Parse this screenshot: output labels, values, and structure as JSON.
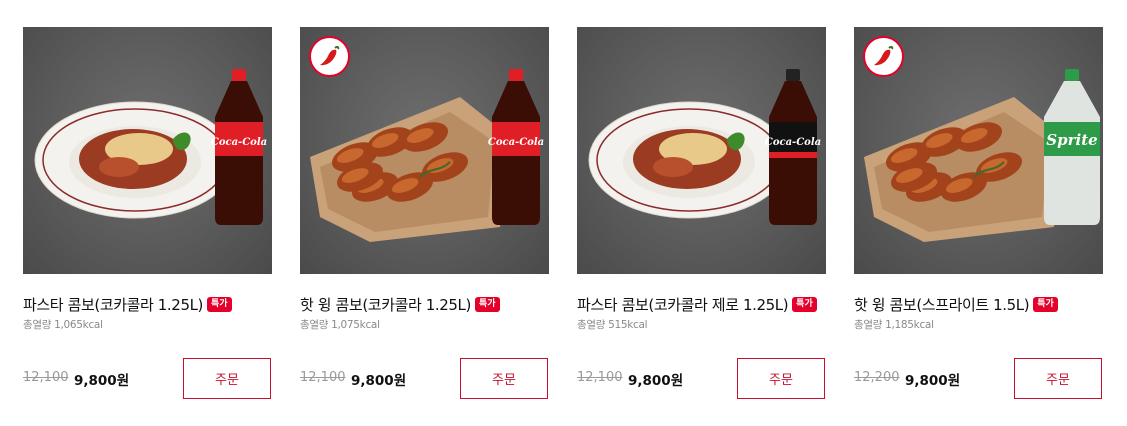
{
  "products": [
    {
      "name": "파스타 콤보(코카콜라 1.25L)",
      "badge": "특가",
      "calories": "총열량 1,065kcal",
      "original_price": "12,100",
      "sale_price": "9,800원",
      "order_label": "주문",
      "spicy": false,
      "food": "pasta",
      "drink": "coca-cola-red",
      "drink_label": "Coca-Cola"
    },
    {
      "name": "핫 윙 콤보(코카콜라 1.25L)",
      "badge": "특가",
      "calories": "총열량 1,075kcal",
      "original_price": "12,100",
      "sale_price": "9,800원",
      "order_label": "주문",
      "spicy": true,
      "food": "wings",
      "drink": "coca-cola-red",
      "drink_label": "Coca-Cola"
    },
    {
      "name": "파스타 콤보(코카콜라 제로 1.25L)",
      "badge": "특가",
      "calories": "총열량 515kcal",
      "original_price": "12,100",
      "sale_price": "9,800원",
      "order_label": "주문",
      "spicy": false,
      "food": "pasta",
      "drink": "coca-cola-zero",
      "drink_label": "Coca-Cola"
    },
    {
      "name": "핫 윙 콤보(스프라이트 1.5L)",
      "badge": "특가",
      "calories": "총열량 1,185kcal",
      "original_price": "12,200",
      "sale_price": "9,800원",
      "order_label": "주문",
      "spicy": true,
      "food": "wings",
      "drink": "sprite",
      "drink_label": "Sprite"
    }
  ],
  "colors": {
    "accent": "#e4002b",
    "button_border": "#c8102e",
    "text": "#111111",
    "muted": "#8a8a8a"
  }
}
